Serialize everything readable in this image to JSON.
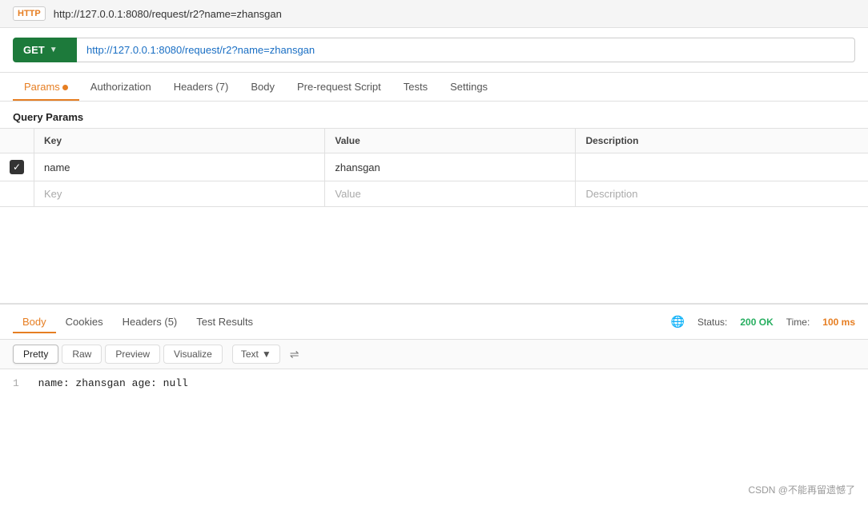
{
  "topbar": {
    "http_badge": "HTTP",
    "url": "http://127.0.0.1:8080/request/r2?name=zhansgan"
  },
  "request": {
    "method": "GET",
    "url": "http://127.0.0.1:8080/request/r2?name=zhansgan"
  },
  "tabs": [
    {
      "label": "Params",
      "has_dot": true,
      "active": true
    },
    {
      "label": "Authorization",
      "has_dot": false,
      "active": false
    },
    {
      "label": "Headers (7)",
      "has_dot": false,
      "active": false
    },
    {
      "label": "Body",
      "has_dot": false,
      "active": false
    },
    {
      "label": "Pre-request Script",
      "has_dot": false,
      "active": false
    },
    {
      "label": "Tests",
      "has_dot": false,
      "active": false
    },
    {
      "label": "Settings",
      "has_dot": false,
      "active": false
    }
  ],
  "query_params": {
    "section_label": "Query Params",
    "columns": [
      "",
      "Key",
      "Value",
      "Description"
    ],
    "rows": [
      {
        "checked": true,
        "key": "name",
        "value": "zhansgan",
        "description": ""
      }
    ],
    "empty_row": {
      "key_placeholder": "Key",
      "value_placeholder": "Value",
      "desc_placeholder": "Description"
    }
  },
  "response": {
    "tabs": [
      {
        "label": "Body",
        "active": true
      },
      {
        "label": "Cookies",
        "active": false
      },
      {
        "label": "Headers (5)",
        "active": false
      },
      {
        "label": "Test Results",
        "active": false
      }
    ],
    "status_label": "Status:",
    "status_value": "200 OK",
    "time_label": "Time:",
    "time_value": "100 ms",
    "format_buttons": [
      {
        "label": "Pretty",
        "active": true
      },
      {
        "label": "Raw",
        "active": false
      },
      {
        "label": "Preview",
        "active": false
      },
      {
        "label": "Visualize",
        "active": false
      }
    ],
    "text_select": "Text",
    "body_line": "1",
    "body_content": "name: zhansgan age: null"
  },
  "watermark": "CSDN @不能再留遗憾了"
}
